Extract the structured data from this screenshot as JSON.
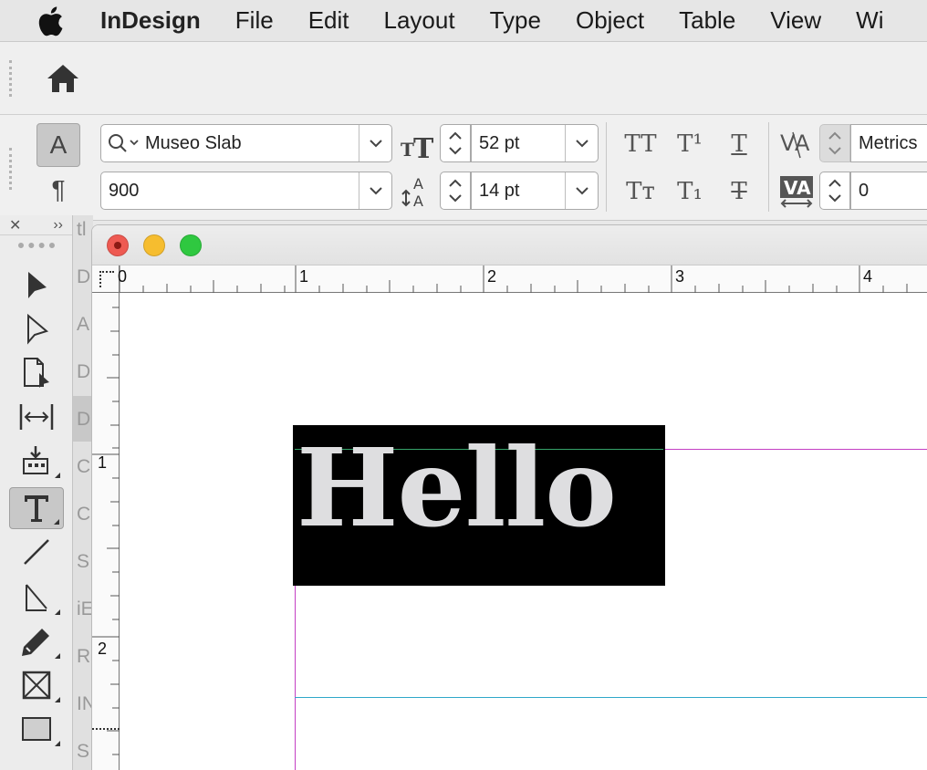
{
  "menubar": {
    "app_name": "InDesign",
    "items": [
      "File",
      "Edit",
      "Layout",
      "Type",
      "Object",
      "Table",
      "View",
      "Wi"
    ]
  },
  "control": {
    "char_toggle": "A",
    "para_toggle": "¶",
    "font_family": "Museo Slab",
    "font_style": "900",
    "font_size": "52 pt",
    "leading": "14 pt",
    "kerning": "Metrics",
    "tracking": "0",
    "caps_labels": [
      "TT",
      "T¹",
      "T",
      "Tт",
      "T₁",
      "T"
    ]
  },
  "tools_panel": {
    "close": "✕",
    "collapse": "››"
  },
  "side_strip_letters": [
    "tl",
    "D",
    "A",
    "D",
    "D",
    "C",
    "C",
    "S",
    "iE",
    "R",
    "IN",
    "S"
  ],
  "document": {
    "ruler_h": [
      "0",
      "1",
      "2",
      "3",
      "4"
    ],
    "ruler_v": [
      "1",
      "2"
    ],
    "text": "Hello"
  },
  "colors": {
    "margin_guide": "#c43fc4",
    "bleed_guide": "#2fa7c9",
    "text_frame_guide": "#36a36b"
  }
}
